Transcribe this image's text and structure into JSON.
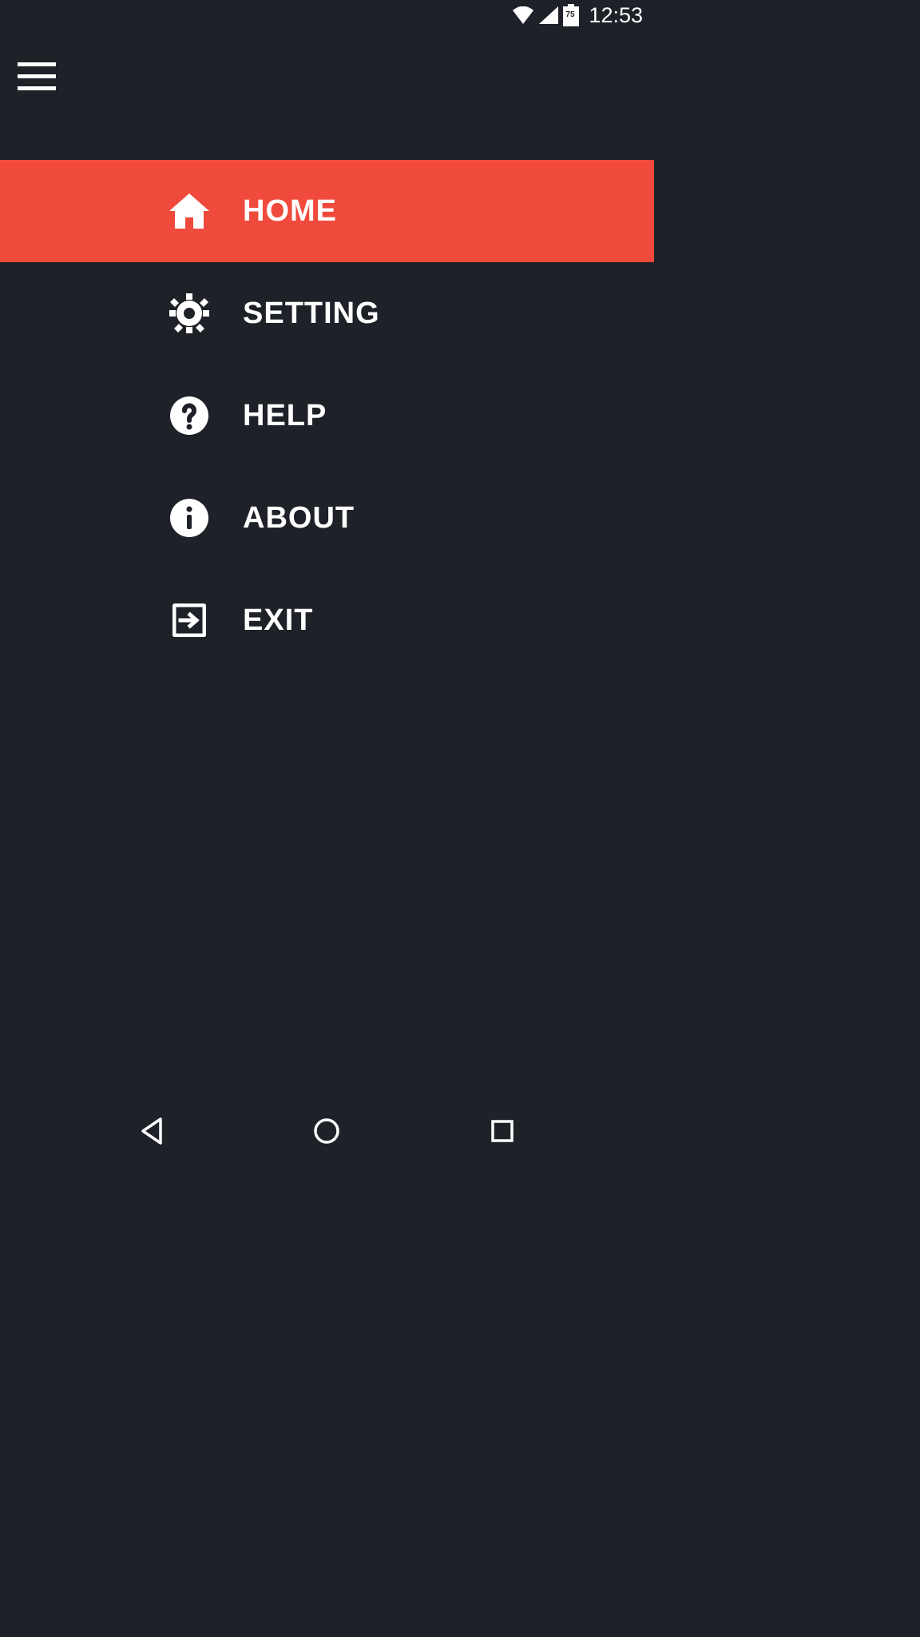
{
  "status": {
    "time": "12:53",
    "battery_percent": "75"
  },
  "menu": {
    "items": [
      {
        "label": "Home",
        "icon": "home-icon",
        "active": true
      },
      {
        "label": "Setting",
        "icon": "gear-icon",
        "active": false
      },
      {
        "label": "Help",
        "icon": "help-icon",
        "active": false
      },
      {
        "label": "About",
        "icon": "info-icon",
        "active": false
      },
      {
        "label": "Exit",
        "icon": "exit-icon",
        "active": false
      }
    ]
  },
  "colors": {
    "background": "#1e2128",
    "accent": "#ef4a3b",
    "text": "#ffffff"
  }
}
